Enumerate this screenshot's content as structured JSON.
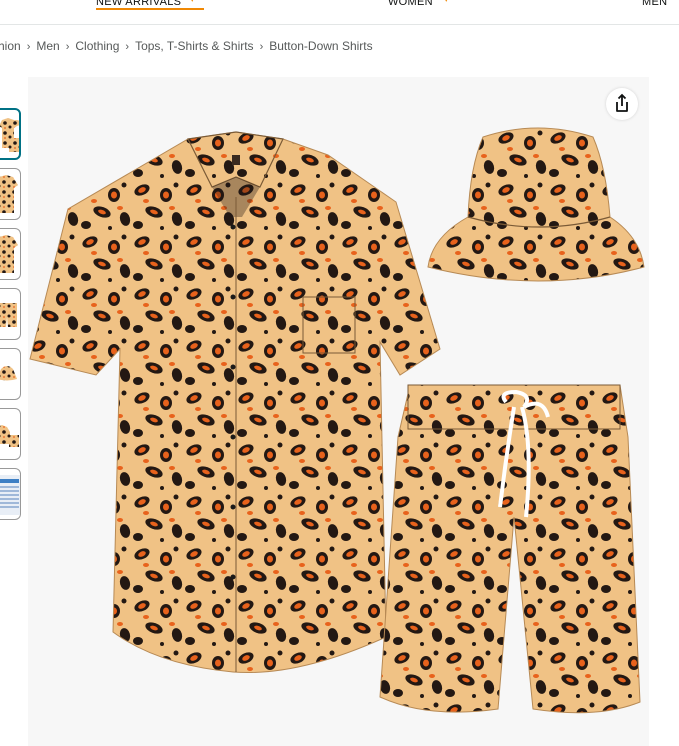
{
  "nav": {
    "new_arrivals": "NEW ARRIVALS",
    "women": "WOMEN",
    "men": "MEN"
  },
  "breadcrumb": [
    "hion",
    "Men",
    "Clothing",
    "Tops, T-Shirts & Shirts",
    "Button-Down Shirts"
  ],
  "breadcrumb_separator": "›",
  "icons": {
    "share": "share-icon",
    "caret": "chevron-down-icon"
  },
  "colors": {
    "accent": "#f08804",
    "thumb_active": "#007185",
    "leopard_base": "#f0c285",
    "leopard_spot": "#231813",
    "leopard_orange": "#e8621c"
  },
  "product": {
    "thumbnails": [
      "outfit-set",
      "shirt-front",
      "shirt-back",
      "shorts",
      "bucket-hat",
      "outfit-flat",
      "size-chart"
    ]
  }
}
